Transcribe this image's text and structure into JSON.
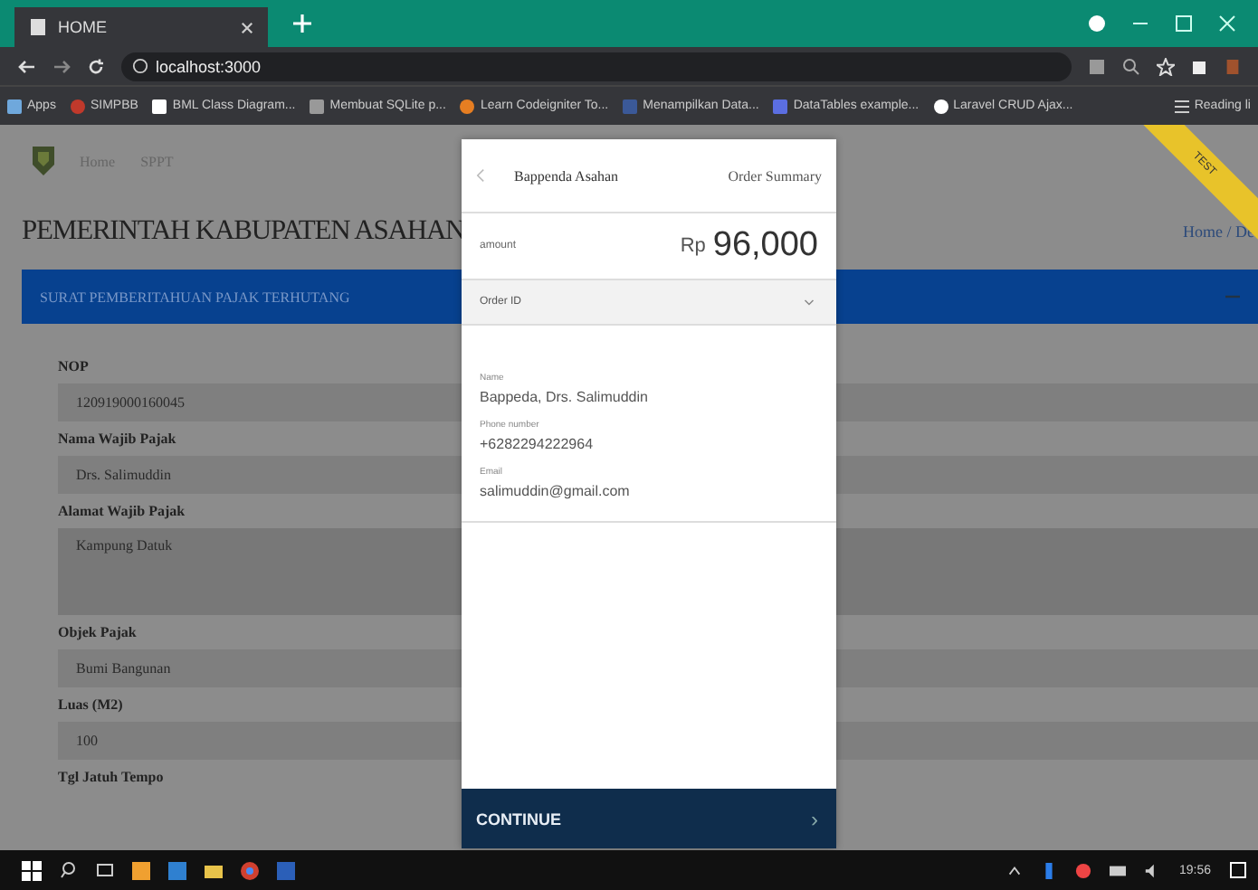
{
  "browser": {
    "tab_title": "HOME",
    "url": "localhost:3000",
    "bookmarks": [
      "Apps",
      "SIMPBB",
      "BML Class Diagram...",
      "Membuat SQLite p...",
      "Learn Codeigniter To...",
      "Menampilkan Data...",
      "DataTables example...",
      "Laravel CRUD Ajax..."
    ],
    "reading_list": "Reading li"
  },
  "page": {
    "breadcrumb": [
      "Home",
      "SPPT"
    ],
    "title": "PEMERINTAH KABUPATEN ASAHAN",
    "right_breadcrumb": "Home / De",
    "banner": "SURAT PEMBERITAHUAN PAJAK TERHUTANG",
    "ribbon": "TEST",
    "fields": [
      {
        "label": "NOP",
        "value": "120919000160045",
        "kind": "input"
      },
      {
        "label": "Nama Wajib Pajak",
        "value": "Drs. Salimuddin",
        "kind": "input"
      },
      {
        "label": "Alamat Wajib Pajak",
        "value": "Kampung Datuk",
        "kind": "textarea"
      },
      {
        "label": "Objek Pajak",
        "value": "Bumi Bangunan",
        "kind": "input"
      },
      {
        "label": "Luas (M2)",
        "value": "100",
        "kind": "input"
      },
      {
        "label": "Tgl Jatuh Tempo",
        "kind": "label"
      }
    ]
  },
  "payment": {
    "merchant": "Bappenda Asahan",
    "header_right": "Order Summary",
    "amount_label": "amount",
    "currency": "Rp",
    "amount": "96,000",
    "order_id_label": "Order ID",
    "details": [
      {
        "label": "Name",
        "value": "Bappeda, Drs. Salimuddin"
      },
      {
        "label": "Phone number",
        "value": "+6282294222964"
      },
      {
        "label": "Email",
        "value": "salimuddin@gmail.com"
      }
    ],
    "continue": "CONTINUE",
    "continue_arrow": "›"
  },
  "taskbar": {
    "time": "19:56"
  }
}
